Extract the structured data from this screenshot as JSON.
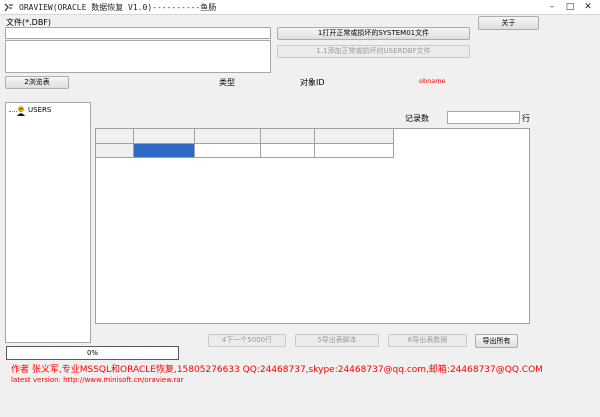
{
  "window": {
    "title": "ORAVIEW(ORACLE 数据恢复 V1.0)----------鱼肠",
    "minimize": "–",
    "maximize": "□",
    "close": "✕"
  },
  "file": {
    "label": "文件(*.DBF)",
    "path_value": "",
    "path_list_value": ""
  },
  "buttons": {
    "open_system": "1打开正常或损坏的SYSTEM01文件",
    "add_userdbf": "1.1添加正常或损坏的USERDBF文件",
    "about": "关于",
    "browse_tables": "2浏览表",
    "next_rows": "4下一个5000行",
    "export_script": "5导出表脚本",
    "export_data": "6导出表数据",
    "export_all": "导出所有"
  },
  "info": {
    "type_label": "类型",
    "object_id_label": "对象ID",
    "obname": "obname",
    "record_count_label": "记录数",
    "record_count_value": "",
    "rows_unit": "行"
  },
  "tree": {
    "items": [
      {
        "label": "USERS",
        "icon": "user-icon"
      }
    ]
  },
  "progress": {
    "text": "0%"
  },
  "footer": {
    "author": "作者 张义军,专业MSSQL和ORACLE恢复,15805276633 QQ:24468737,skype:24468737@qq.com,邮箱:24468737@QQ.COM",
    "version": "latest version: http://www.minisoft.cn/oraview.rar"
  },
  "colors": {
    "accent_red": "#ff0000",
    "selection_blue": "#3169c6",
    "window_bg": "#f0f0f0"
  }
}
